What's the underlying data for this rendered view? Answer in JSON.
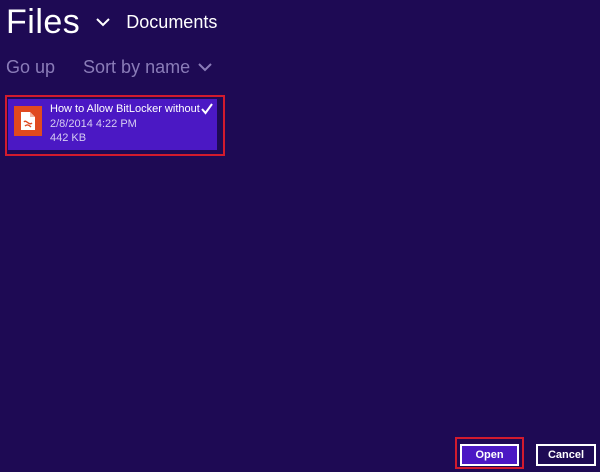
{
  "header": {
    "title": "Files",
    "location": "Documents"
  },
  "toolbar": {
    "go_up_label": "Go up",
    "sort_label": "Sort by name"
  },
  "files": [
    {
      "name": "How to Allow BitLocker without...",
      "date": "2/8/2014 4:22 PM",
      "size": "442 KB",
      "selected": true
    }
  ],
  "actions": {
    "open_label": "Open",
    "cancel_label": "Cancel"
  },
  "colors": {
    "background": "#1e0a54",
    "accent": "#4b18c4",
    "file_icon": "#e04a1f",
    "highlight": "#d21b2e",
    "muted_text": "#8a7cb8"
  },
  "icons": {
    "title_dropdown": "chevron-down-icon",
    "sort_dropdown": "chevron-down-icon",
    "file_type": "pdf-file-icon",
    "selected": "checkmark-icon"
  }
}
